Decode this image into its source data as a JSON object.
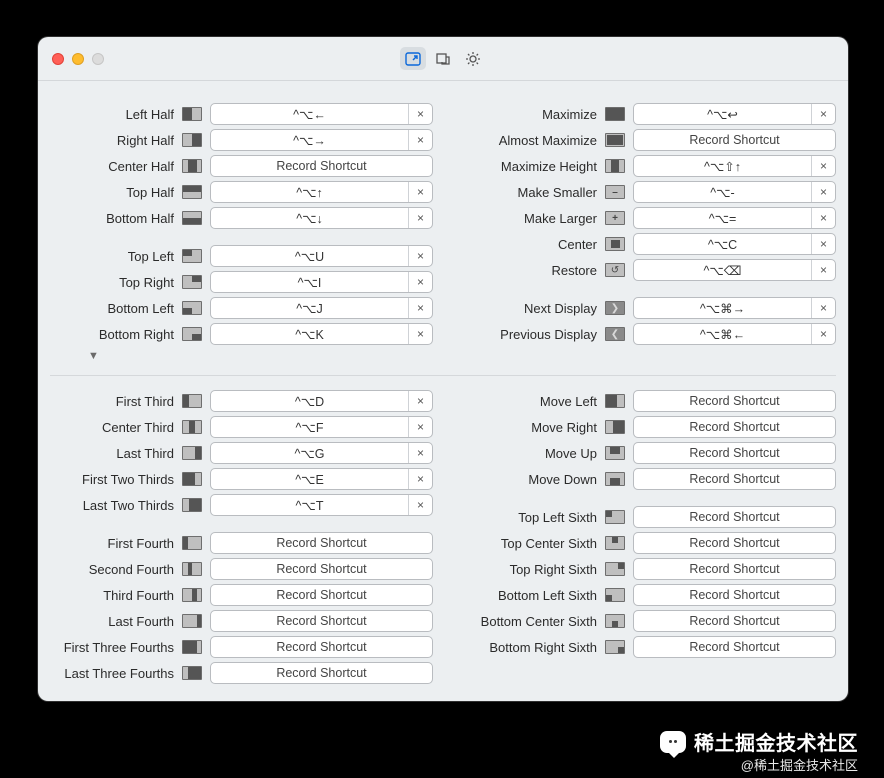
{
  "record_label": "Record Shortcut",
  "clear_glyph": "×",
  "watermark": {
    "name": "稀土掘金技术社区",
    "handle": "@稀土掘金技术社区"
  },
  "left1": [
    {
      "label": "Left Half",
      "shortcut": "^⌥←",
      "has": true,
      "icon": "left-half"
    },
    {
      "label": "Right Half",
      "shortcut": "^⌥→",
      "has": true,
      "icon": "right-half"
    },
    {
      "label": "Center Half",
      "shortcut": "",
      "has": false,
      "icon": "center-half"
    },
    {
      "label": "Top Half",
      "shortcut": "^⌥↑",
      "has": true,
      "icon": "top-half"
    },
    {
      "label": "Bottom Half",
      "shortcut": "^⌥↓",
      "has": true,
      "icon": "bottom-half"
    }
  ],
  "left2": [
    {
      "label": "Top Left",
      "shortcut": "^⌥U",
      "has": true,
      "icon": "top-left"
    },
    {
      "label": "Top Right",
      "shortcut": "^⌥I",
      "has": true,
      "icon": "top-right"
    },
    {
      "label": "Bottom Left",
      "shortcut": "^⌥J",
      "has": true,
      "icon": "bottom-left"
    },
    {
      "label": "Bottom Right",
      "shortcut": "^⌥K",
      "has": true,
      "icon": "bottom-right"
    }
  ],
  "right1": [
    {
      "label": "Maximize",
      "shortcut": "^⌥↩",
      "has": true,
      "icon": "maximize"
    },
    {
      "label": "Almost Maximize",
      "shortcut": "",
      "has": false,
      "icon": "almost-max"
    },
    {
      "label": "Maximize Height",
      "shortcut": "^⌥⇧↑",
      "has": true,
      "icon": "max-height"
    },
    {
      "label": "Make Smaller",
      "shortcut": "^⌥-",
      "has": true,
      "icon": "smaller"
    },
    {
      "label": "Make Larger",
      "shortcut": "^⌥=",
      "has": true,
      "icon": "larger"
    },
    {
      "label": "Center",
      "shortcut": "^⌥C",
      "has": true,
      "icon": "center"
    },
    {
      "label": "Restore",
      "shortcut": "^⌥⌫",
      "has": true,
      "icon": "restore"
    }
  ],
  "right2": [
    {
      "label": "Next Display",
      "shortcut": "^⌥⌘→",
      "has": true,
      "icon": "next-display"
    },
    {
      "label": "Previous Display",
      "shortcut": "^⌥⌘←",
      "has": true,
      "icon": "prev-display"
    }
  ],
  "bl1": [
    {
      "label": "First Third",
      "shortcut": "^⌥D",
      "has": true,
      "icon": "third-1"
    },
    {
      "label": "Center Third",
      "shortcut": "^⌥F",
      "has": true,
      "icon": "third-2"
    },
    {
      "label": "Last Third",
      "shortcut": "^⌥G",
      "has": true,
      "icon": "third-3"
    },
    {
      "label": "First Two Thirds",
      "shortcut": "^⌥E",
      "has": true,
      "icon": "third-12"
    },
    {
      "label": "Last Two Thirds",
      "shortcut": "^⌥T",
      "has": true,
      "icon": "third-23"
    }
  ],
  "bl2": [
    {
      "label": "First Fourth",
      "shortcut": "",
      "has": false,
      "icon": "fourth-1"
    },
    {
      "label": "Second Fourth",
      "shortcut": "",
      "has": false,
      "icon": "fourth-2"
    },
    {
      "label": "Third Fourth",
      "shortcut": "",
      "has": false,
      "icon": "fourth-3"
    },
    {
      "label": "Last Fourth",
      "shortcut": "",
      "has": false,
      "icon": "fourth-4"
    },
    {
      "label": "First Three Fourths",
      "shortcut": "",
      "has": false,
      "icon": "fourth-123"
    },
    {
      "label": "Last Three Fourths",
      "shortcut": "",
      "has": false,
      "icon": "fourth-234"
    }
  ],
  "br1": [
    {
      "label": "Move Left",
      "shortcut": "",
      "has": false,
      "icon": "move-left"
    },
    {
      "label": "Move Right",
      "shortcut": "",
      "has": false,
      "icon": "move-right"
    },
    {
      "label": "Move Up",
      "shortcut": "",
      "has": false,
      "icon": "move-up"
    },
    {
      "label": "Move Down",
      "shortcut": "",
      "has": false,
      "icon": "move-down"
    }
  ],
  "br2": [
    {
      "label": "Top Left Sixth",
      "shortcut": "",
      "has": false,
      "icon": "six-tl"
    },
    {
      "label": "Top Center Sixth",
      "shortcut": "",
      "has": false,
      "icon": "six-tc"
    },
    {
      "label": "Top Right Sixth",
      "shortcut": "",
      "has": false,
      "icon": "six-tr"
    },
    {
      "label": "Bottom Left Sixth",
      "shortcut": "",
      "has": false,
      "icon": "six-bl"
    },
    {
      "label": "Bottom Center Sixth",
      "shortcut": "",
      "has": false,
      "icon": "six-bc"
    },
    {
      "label": "Bottom Right Sixth",
      "shortcut": "",
      "has": false,
      "icon": "six-br"
    }
  ]
}
